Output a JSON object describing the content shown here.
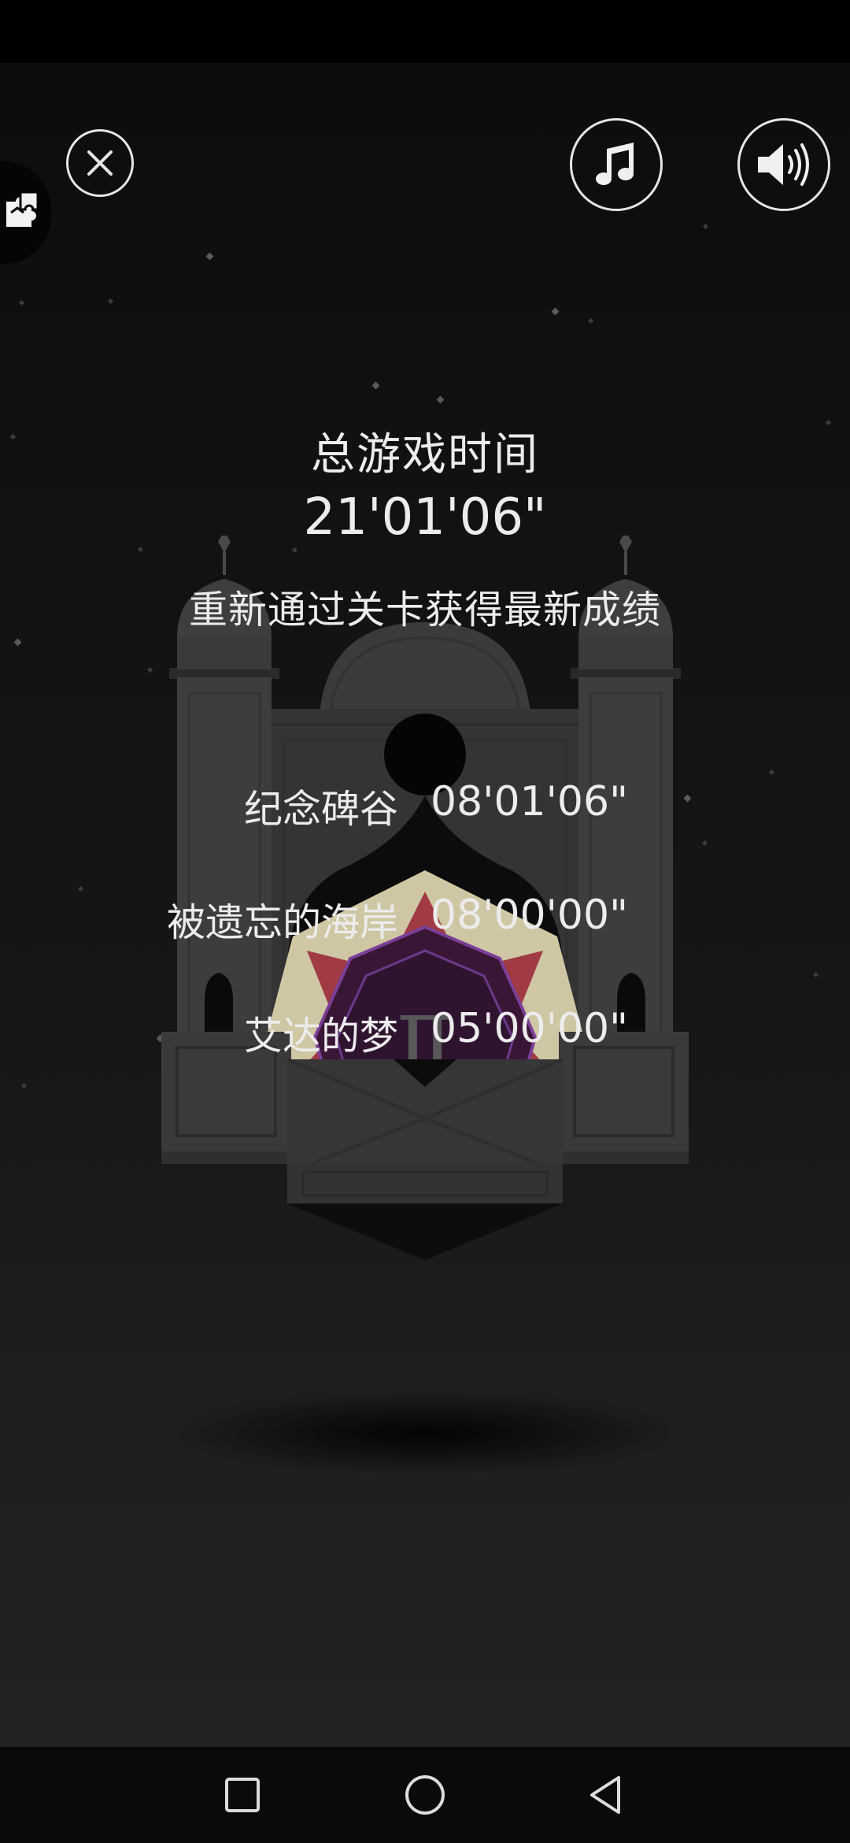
{
  "stats": {
    "total_title": "总游戏时间",
    "total_time": "21'01'06\"",
    "hint": "重新通过关卡获得最新成绩"
  },
  "records": [
    {
      "name": "纪念碑谷",
      "time": "08'01'06\""
    },
    {
      "name": "被遗忘的海岸",
      "time": "08'00'00\""
    },
    {
      "name": "艾达的梦",
      "time": "05'00'00\""
    }
  ],
  "monument": {
    "roman_numeral": "Ⅱ"
  },
  "icons": {
    "close": "close-icon",
    "music": "music-note-icon",
    "sound": "speaker-icon",
    "side": "puzzle-icon",
    "nav_recent": "square-icon",
    "nav_home": "circle-icon",
    "nav_back": "triangle-back-icon"
  },
  "colors": {
    "text": "#ececec",
    "stone": "#3a3a3a",
    "stone_dark": "#2b2b2b",
    "medallion_bg": "#cfc6a4",
    "star_red": "#a03a44",
    "medallion_core": "#2f1430",
    "core_outline": "#6a3a8a"
  }
}
